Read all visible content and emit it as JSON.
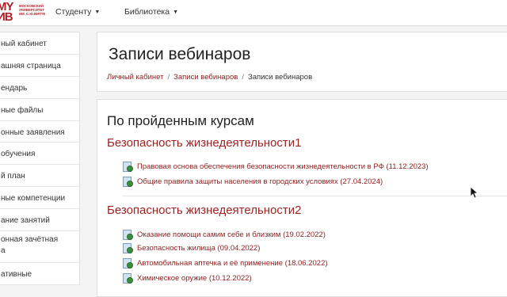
{
  "header": {
    "logo_big": "MY\nИВ",
    "logo_small": "МОСКОВСКИЙ\nУНИВЕРСИТЕТ\nИМ. С.Ю.ВИТТЕ",
    "nav": [
      {
        "label": "Студенту"
      },
      {
        "label": "Библиотека"
      }
    ]
  },
  "sidebar": {
    "items": [
      {
        "label": "ный кабинет"
      },
      {
        "label": "ашняя страница"
      },
      {
        "label": "ендарь"
      },
      {
        "label": "ные файлы"
      },
      {
        "label": "онные заявления"
      },
      {
        "label": "обучения"
      },
      {
        "label": "й план"
      },
      {
        "label": "ные компетенции"
      },
      {
        "label": "ание занятий"
      },
      {
        "label": "онная зачётная\nа"
      },
      {
        "label": "ативные"
      }
    ]
  },
  "main": {
    "title": "Записи вебинаров",
    "breadcrumb": [
      {
        "label": "Личный кабинет"
      },
      {
        "label": "Записи вебинаров"
      },
      {
        "label": "Записи вебинаров"
      }
    ],
    "section_title": "По пройденным курсам",
    "courses": [
      {
        "title": "Безопасность жизнедеятельности1",
        "lessons": [
          {
            "label": "Правовая основа обеспечения безопасности жизнедеятельности в РФ (11.12.2023)"
          },
          {
            "label": "Общие правила защиты населения в городских условиях (27.04.2024)"
          }
        ]
      },
      {
        "title": "Безопасность жизнедеятельности2",
        "lessons": [
          {
            "label": "Оказание помощи самим себе и близким (19.02.2022)"
          },
          {
            "label": "Безопасность жилища (09.04.2022)"
          },
          {
            "label": "Автомобильная аптечка и её применение (18.06.2022)"
          },
          {
            "label": "Химическое оружие (10.12.2022)"
          }
        ]
      }
    ]
  },
  "colors": {
    "link": "#8f1d1d",
    "course_title": "#a02323",
    "brand": "#b21f24"
  }
}
